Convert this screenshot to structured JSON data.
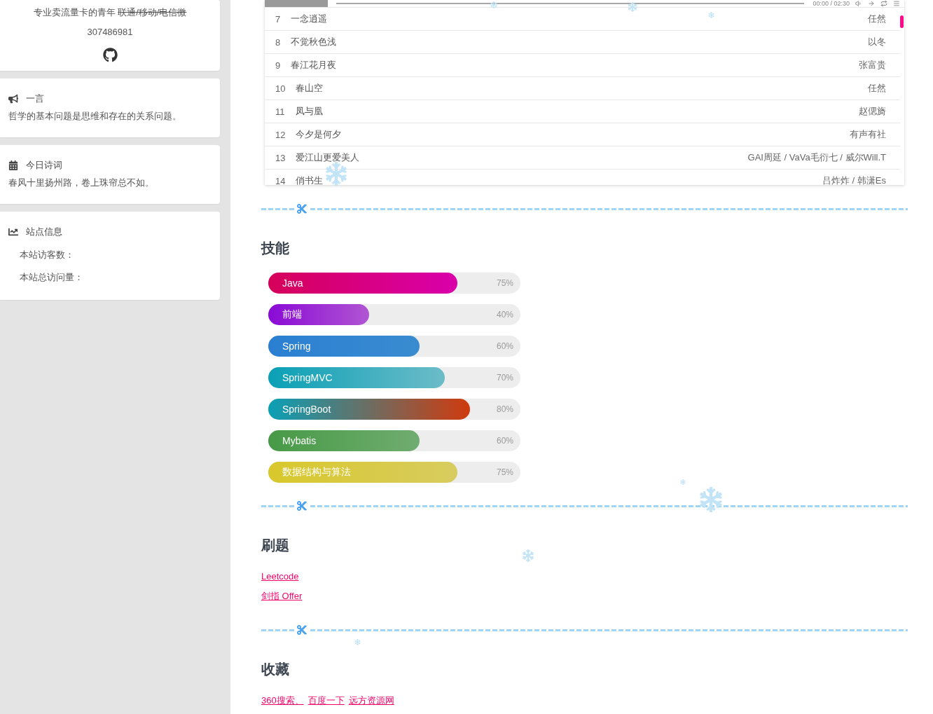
{
  "sidebar": {
    "profile": {
      "intro": [
        {
          "text": "专业卖流量卡的青年 ",
          "struck": false
        },
        {
          "text": "联通/移动/电信微",
          "struck": true
        }
      ],
      "qq": "307486981"
    },
    "cards": [
      {
        "kind": "quote",
        "title": "一言",
        "text": "哲学的基本问题是思维和存在的关系问题。"
      },
      {
        "kind": "poem",
        "title": "今日诗词",
        "text": "春风十里扬州路，卷上珠帘总不如。"
      },
      {
        "kind": "stats",
        "title": "站点信息",
        "lines": [
          "本站访客数：",
          "本站总访问量："
        ]
      }
    ]
  },
  "player": {
    "time": "00:00 / 02:30"
  },
  "playlist": {
    "rows": [
      {
        "number": "7",
        "title": "一念逍遥",
        "artist": "任然"
      },
      {
        "number": "8",
        "title": "不觉秋色浅",
        "artist": "以冬"
      },
      {
        "number": "9",
        "title": "春江花月夜",
        "artist": "张富贵"
      },
      {
        "number": "10",
        "title": "春山空",
        "artist": "任然"
      },
      {
        "number": "11",
        "title": "凤与凰",
        "artist": "赵偲旖"
      },
      {
        "number": "12",
        "title": "今夕是何夕",
        "artist": "有声有社"
      },
      {
        "number": "13",
        "title": "爱江山更爱美人",
        "artist": "GAI周延 / VaVa毛衍七 / 威尔Will.T"
      },
      {
        "number": "14",
        "title": "俏书生",
        "artist": "吕炸炸 / 韩潇Es"
      }
    ]
  },
  "sections": [
    {
      "kind": "skills",
      "title": "技能",
      "skills": [
        {
          "name": "Java",
          "level": 0.75,
          "reading": "75%",
          "stops": [
            {
              "color": "#d6005a"
            },
            {
              "color": "#d900aa"
            }
          ]
        },
        {
          "name": "前端",
          "level": 0.4,
          "reading": "40%",
          "stops": [
            {
              "color": "#8a0ad6"
            },
            {
              "color": "#b055d2"
            }
          ]
        },
        {
          "name": "Spring",
          "level": 0.6,
          "reading": "60%",
          "stops": [
            {
              "color": "#2a7fd2"
            },
            {
              "color": "#3a8cd0"
            }
          ]
        },
        {
          "name": "SpringMVC",
          "level": 0.7,
          "reading": "70%",
          "stops": [
            {
              "color": "#0aa0b6"
            },
            {
              "color": "#6cbcc8"
            }
          ]
        },
        {
          "name": "SpringBoot",
          "level": 0.8,
          "reading": "80%",
          "stops": [
            {
              "color": "#0aa0b6"
            },
            {
              "color": "#d03a0e"
            }
          ]
        },
        {
          "name": "Mybatis",
          "level": 0.6,
          "reading": "60%",
          "stops": [
            {
              "color": "#479a46"
            },
            {
              "color": "#70ac70"
            }
          ]
        },
        {
          "name": "数据结构与算法",
          "level": 0.75,
          "reading": "75%",
          "stops": [
            {
              "color": "#d8c82c"
            },
            {
              "color": "#d8cc60"
            }
          ]
        }
      ]
    },
    {
      "kind": "link_list",
      "title": "刷题",
      "links": [
        "Leetcode",
        "剑指 Offer"
      ]
    },
    {
      "kind": "link_row",
      "title": "收藏",
      "links": [
        "360搜索、",
        "百度一下",
        "远方资源网"
      ]
    }
  ]
}
